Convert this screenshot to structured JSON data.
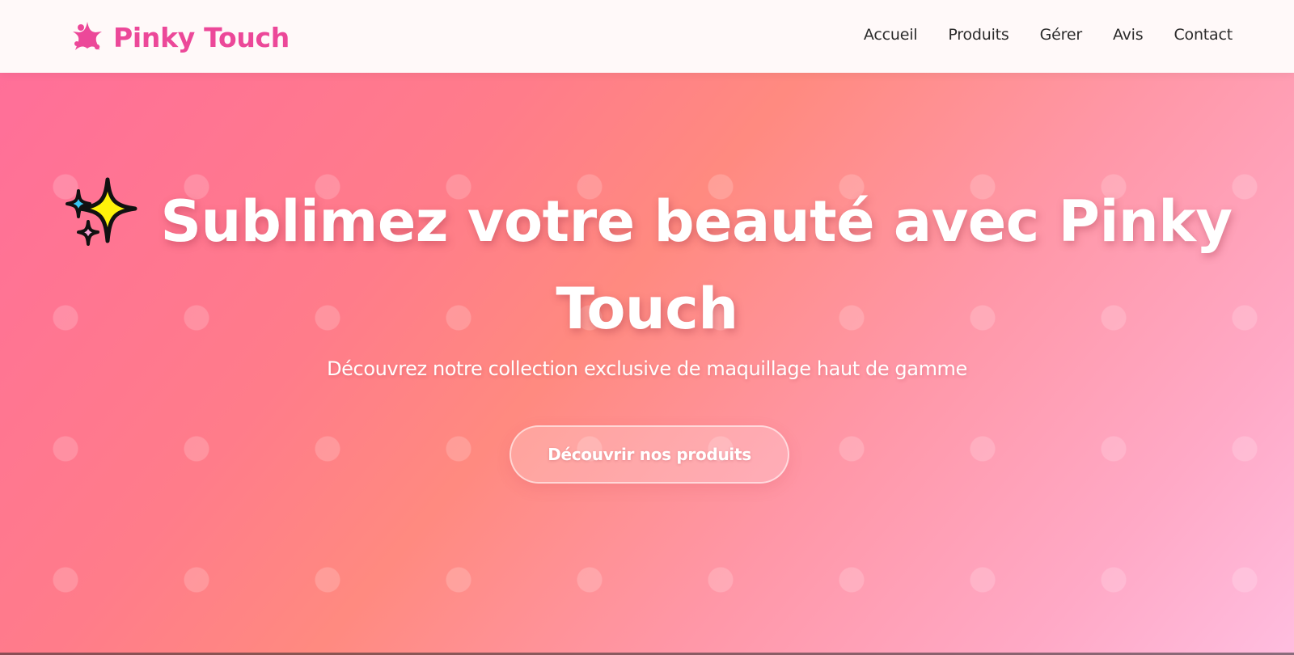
{
  "header": {
    "brand_name": "Pinky Touch",
    "brand_icon": "sparkle-star-icon",
    "nav": [
      {
        "label": "Accueil"
      },
      {
        "label": "Produits"
      },
      {
        "label": "Gérer"
      },
      {
        "label": "Avis"
      },
      {
        "label": "Contact"
      }
    ]
  },
  "hero": {
    "title_icon": "sparkles-emoji-icon",
    "title": "Sublimez votre beauté avec Pinky Touch",
    "subtitle": "Découvrez notre collection exclusive de maquillage haut de gamme",
    "cta_label": "Découvrir nos produits"
  },
  "colors": {
    "brand": "#ec4899",
    "hero_gradient_start": "#ff6f99",
    "hero_gradient_mid": "#ff8a80",
    "hero_gradient_end": "#ffbddf",
    "nav_text": "#2b2b2b"
  }
}
